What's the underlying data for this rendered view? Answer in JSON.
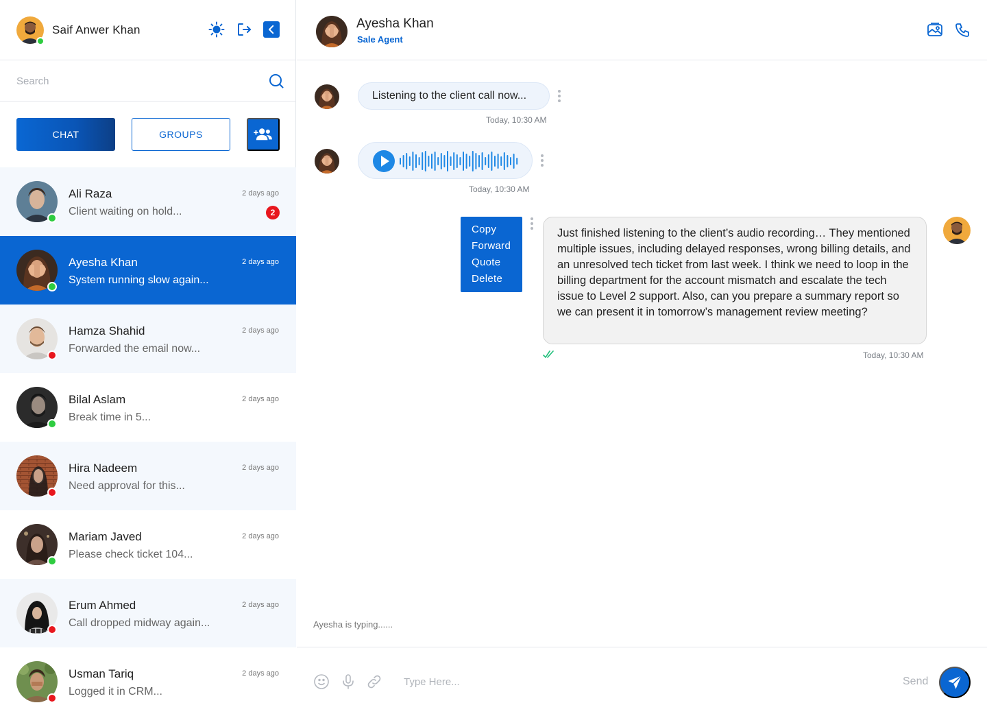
{
  "sidebar": {
    "current_user": {
      "name": "Saif Anwer Khan",
      "status": "online"
    },
    "header_icons": [
      "sun-icon",
      "logout-icon",
      "collapse-chevron-icon"
    ],
    "search": {
      "placeholder": "Search"
    },
    "tabs": {
      "chat": "CHAT",
      "groups": "GROUPS"
    },
    "contacts": [
      {
        "name": "Ali Raza",
        "message": "Client waiting on hold...",
        "time": "2 days ago",
        "status": "online",
        "unread": "2"
      },
      {
        "name": "Ayesha Khan",
        "message": "System running slow again...",
        "time": "2 days ago",
        "status": "online",
        "active": true
      },
      {
        "name": "Hamza Shahid",
        "message": "Forwarded the email now...",
        "time": "2 days ago",
        "status": "offline"
      },
      {
        "name": "Bilal Aslam",
        "message": "Break time in 5...",
        "time": "2 days ago",
        "status": "online"
      },
      {
        "name": "Hira Nadeem",
        "message": "Need approval for this...",
        "time": "2 days ago",
        "status": "offline"
      },
      {
        "name": "Mariam Javed",
        "message": "Please check ticket 104...",
        "time": "2 days ago",
        "status": "online"
      },
      {
        "name": "Erum Ahmed",
        "message": "Call dropped midway again...",
        "time": "2 days ago",
        "status": "offline"
      },
      {
        "name": "Usman Tariq",
        "message": "Logged it in CRM...",
        "time": "2 days ago",
        "status": "offline"
      }
    ]
  },
  "chat": {
    "peer": {
      "name": "Ayesha Khan",
      "role": "Sale Agent"
    },
    "header_icons": [
      "media-gallery-icon",
      "phone-icon"
    ],
    "messages": [
      {
        "from": "peer",
        "text": "Listening to the client call now...",
        "time": "Today, 10:30 AM"
      },
      {
        "from": "peer",
        "type": "audio",
        "time": "Today, 10:30 AM"
      },
      {
        "from": "me",
        "text": "Just finished listening to the client’s audio recording… They mentioned multiple issues, including delayed responses, wrong billing details, and an unresolved tech ticket from last week. I think we need to loop in the billing department for the account mismatch and escalate the tech issue to Level 2 support. Also, can you prepare a summary report so we can present it in tomorrow’s management review meeting?",
        "time": "Today, 10:30 AM",
        "read": true
      }
    ],
    "context_menu": [
      "Copy",
      "Forward",
      "Quote",
      "Delete"
    ],
    "typing_indicator": "Ayesha is typing......",
    "composer": {
      "placeholder": "Type Here...",
      "send_label": "Send"
    }
  },
  "colors": {
    "accent": "#0a66d2",
    "online": "#2ecc40",
    "offline": "#e8171e",
    "unread_badge": "#e8171e",
    "read_tick": "#1fbf7a"
  }
}
